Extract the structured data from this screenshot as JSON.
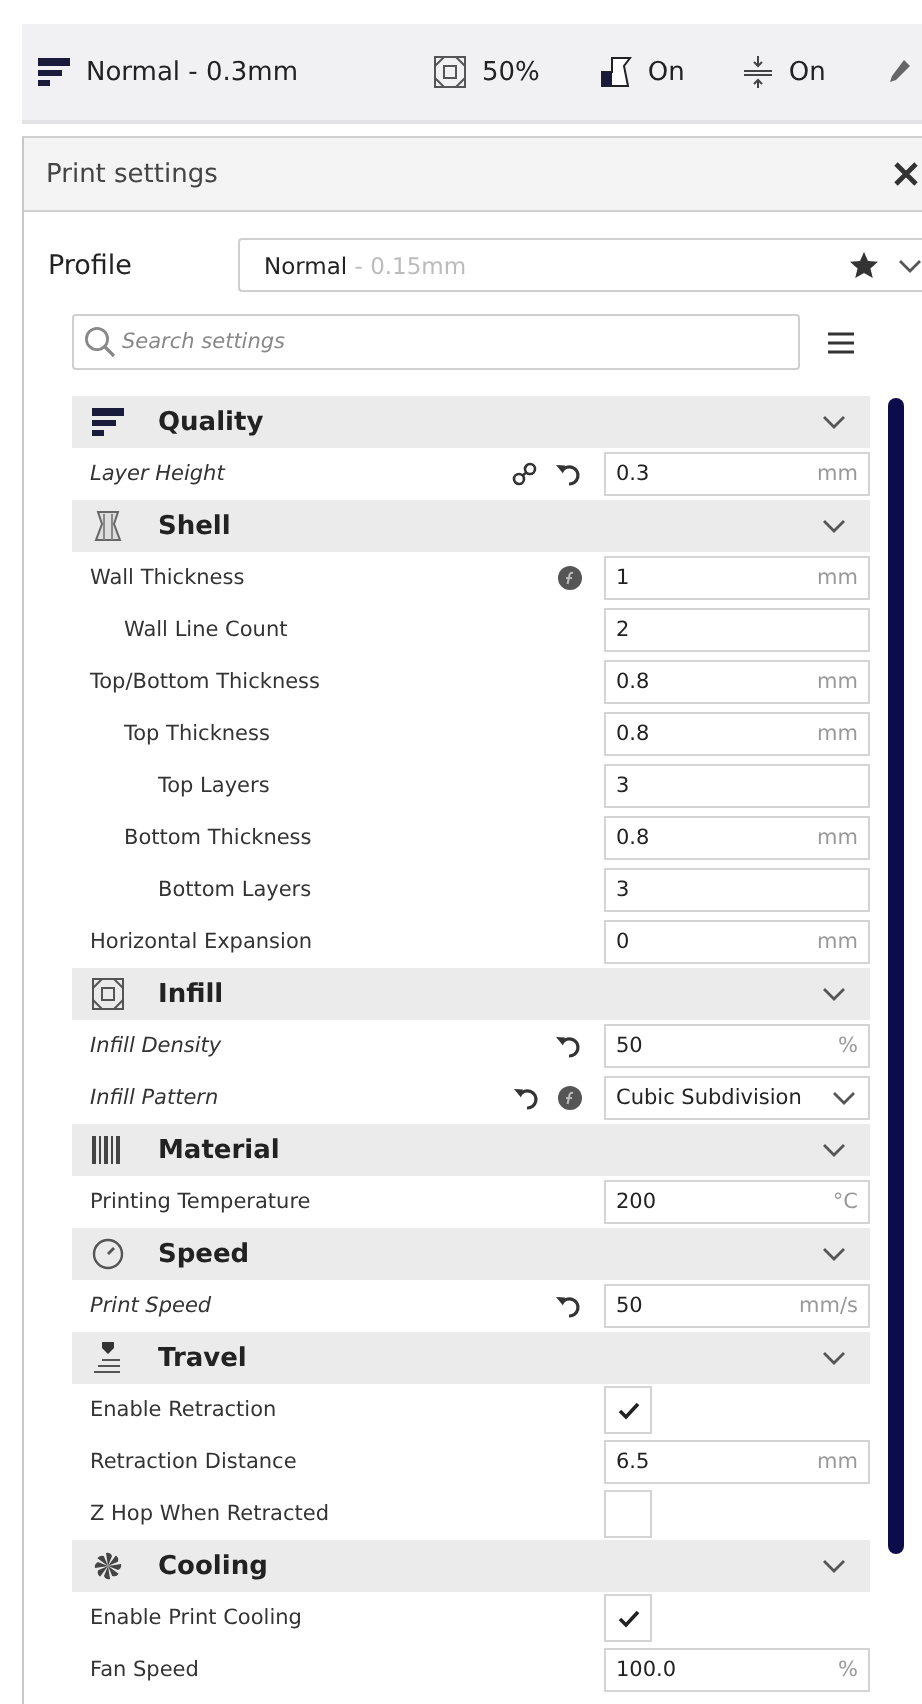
{
  "toolbar": {
    "profile": "Normal - 0.3mm",
    "infill": "50%",
    "support": "On",
    "adhesion": "On"
  },
  "panel": {
    "title": "Print settings",
    "profile_label": "Profile",
    "profile_name": "Normal",
    "profile_detail": " - 0.15mm",
    "search": {
      "placeholder": "Search settings"
    }
  },
  "sections": [
    {
      "title": "Quality",
      "kind": "quality",
      "expanded": true,
      "settings": [
        {
          "label": "Layer Height",
          "modified": true,
          "linked": true,
          "reset": true,
          "control": {
            "kind": "number",
            "value": "0.3",
            "unit": "mm"
          }
        }
      ]
    },
    {
      "title": "Shell",
      "kind": "shell",
      "expanded": true,
      "settings": [
        {
          "label": "Wall Thickness",
          "modified": false,
          "formula": true,
          "control": {
            "kind": "number",
            "value": "1",
            "unit": "mm"
          },
          "children": [
            {
              "label": "Wall Line Count",
              "modified": false,
              "control": {
                "kind": "number",
                "value": "2"
              }
            }
          ]
        },
        {
          "label": "Top/Bottom Thickness",
          "modified": false,
          "control": {
            "kind": "number",
            "value": "0.8",
            "unit": "mm"
          },
          "children": [
            {
              "label": "Top Thickness",
              "modified": false,
              "control": {
                "kind": "number",
                "value": "0.8",
                "unit": "mm"
              },
              "children": [
                {
                  "label": "Top Layers",
                  "modified": false,
                  "control": {
                    "kind": "number",
                    "value": "3"
                  }
                }
              ]
            },
            {
              "label": "Bottom Thickness",
              "modified": false,
              "control": {
                "kind": "number",
                "value": "0.8",
                "unit": "mm"
              },
              "children": [
                {
                  "label": "Bottom Layers",
                  "modified": false,
                  "control": {
                    "kind": "number",
                    "value": "3"
                  }
                }
              ]
            }
          ]
        },
        {
          "label": "Horizontal Expansion",
          "modified": false,
          "control": {
            "kind": "number",
            "value": "0",
            "unit": "mm"
          }
        }
      ]
    },
    {
      "title": "Infill",
      "kind": "infill",
      "expanded": true,
      "settings": [
        {
          "label": "Infill Density",
          "modified": true,
          "reset": true,
          "control": {
            "kind": "number",
            "value": "50",
            "unit": "%"
          }
        },
        {
          "label": "Infill Pattern",
          "modified": true,
          "reset": true,
          "formula": true,
          "control": {
            "kind": "select",
            "value": "Cubic Subdivision"
          }
        }
      ]
    },
    {
      "title": "Material",
      "kind": "material",
      "expanded": true,
      "settings": [
        {
          "label": "Printing Temperature",
          "modified": false,
          "control": {
            "kind": "number",
            "value": "200",
            "unit": "°C"
          }
        }
      ]
    },
    {
      "title": "Speed",
      "kind": "speed",
      "expanded": true,
      "settings": [
        {
          "label": "Print Speed",
          "modified": true,
          "reset": true,
          "control": {
            "kind": "number",
            "value": "50",
            "unit": "mm/s"
          }
        }
      ]
    },
    {
      "title": "Travel",
      "kind": "travel",
      "expanded": true,
      "settings": [
        {
          "label": "Enable Retraction",
          "modified": false,
          "control": {
            "kind": "checkbox",
            "checked": true
          }
        },
        {
          "label": "Retraction Distance",
          "modified": false,
          "control": {
            "kind": "number",
            "value": "6.5",
            "unit": "mm"
          }
        },
        {
          "label": "Z Hop When Retracted",
          "modified": false,
          "control": {
            "kind": "checkbox",
            "checked": false
          }
        }
      ]
    },
    {
      "title": "Cooling",
      "kind": "cooling",
      "expanded": true,
      "settings": [
        {
          "label": "Enable Print Cooling",
          "modified": false,
          "control": {
            "kind": "checkbox",
            "checked": true
          }
        },
        {
          "label": "Fan Speed",
          "modified": false,
          "control": {
            "kind": "number",
            "value": "100.0",
            "unit": "%"
          }
        }
      ]
    }
  ]
}
